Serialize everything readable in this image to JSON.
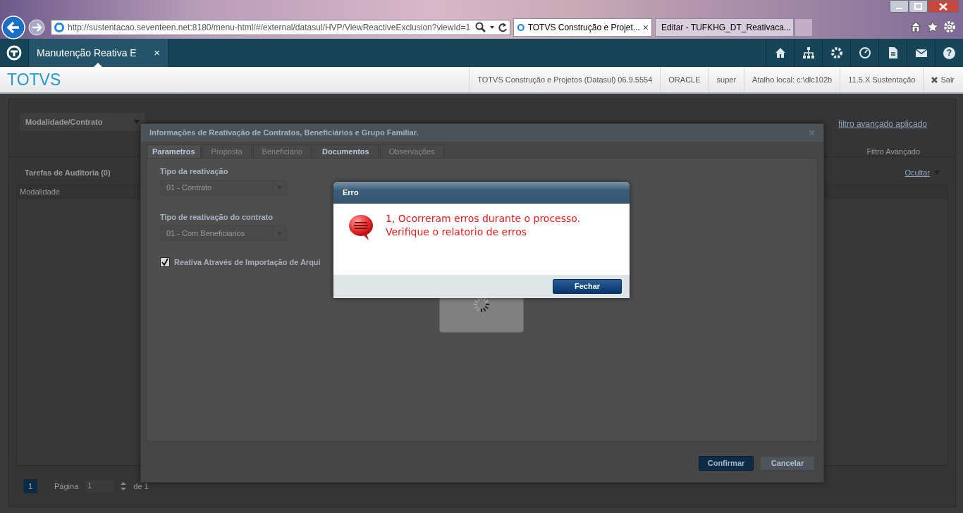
{
  "browser": {
    "url": "http://sustentacao.seventeen.net:8180/menu-html/#/external/datasul/HVP/ViewReactiveExclusion?viewId=1",
    "tabs": [
      {
        "title": "TOTVS Construção e Projet...",
        "close": "×",
        "selected": true
      },
      {
        "title": "Editar - TUFKHG_DT_Reativaca...",
        "selected": false
      }
    ]
  },
  "app_nav": {
    "tab": {
      "label": "Manutenção Reativa E",
      "close": "×"
    },
    "help_label": "?"
  },
  "header": {
    "brand": "TOTVS",
    "items": [
      "TOTVS Construção e Projetos (Datasul) 06.9.5554",
      "ORACLE",
      "super",
      "Atalho local: c:\\dlc102b",
      "11.5.X Sustentação"
    ],
    "logout": "Sair"
  },
  "page": {
    "filter_select": "Modalidade/Contrato",
    "filter_link": "filtro avançado aplicado",
    "filter_button": "Filtro Avançado",
    "section_title": "Tarefas de Auditoria (0)",
    "hide_link": "Ocultar",
    "column": "Modalidade",
    "pager": {
      "current": "1",
      "label": "Página",
      "page": "1",
      "total": "de 1"
    }
  },
  "modal": {
    "title": "Informações de Reativação de Contratos, Beneficiários e Grupo Familiar.",
    "tabs": [
      {
        "label": "Parametros",
        "selected": true,
        "disabled": false
      },
      {
        "label": "Proposta",
        "selected": false,
        "disabled": true
      },
      {
        "label": "Beneficiário",
        "selected": false,
        "disabled": true
      },
      {
        "label": "Documentos",
        "selected": false,
        "disabled": false
      },
      {
        "label": "Observações",
        "selected": false,
        "disabled": true
      }
    ],
    "fields": [
      {
        "label": "Tipo da reativação",
        "value": "01 - Contrato"
      },
      {
        "label": "Tipo de reativação do contrato",
        "value": "01 - Com Beneficiarios"
      }
    ],
    "checkbox": {
      "label": "Reativa Através de Importação de Arqui",
      "checked": true
    },
    "buttons": [
      {
        "label": "Confirmar",
        "kind": "primary"
      },
      {
        "label": "Cancelar",
        "kind": "secondary"
      }
    ]
  },
  "error_dialog": {
    "title": "Erro",
    "message": [
      "1, Ocorreram erros durante o processo.",
      "Verifique o relatorio de erros"
    ],
    "button": "Fechar"
  }
}
